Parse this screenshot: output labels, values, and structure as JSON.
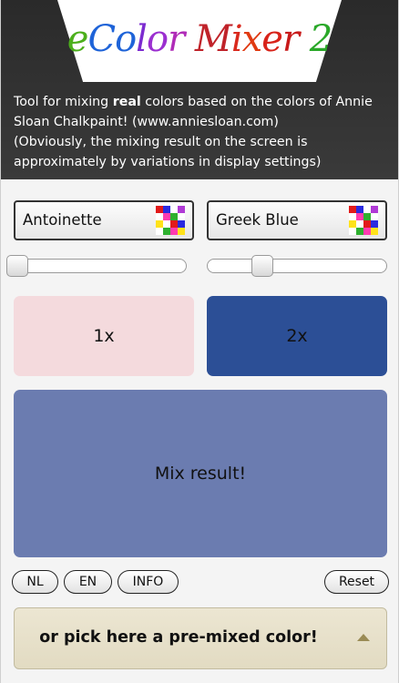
{
  "header": {
    "logo": [
      {
        "text": "e",
        "color": "#4caf1c"
      },
      {
        "text": "C",
        "color": "#1e63d8"
      },
      {
        "text": "o",
        "color": "#1e63d8"
      },
      {
        "text": "l",
        "color": "#7c2bd0"
      },
      {
        "text": "o",
        "color": "#9b2fd0"
      },
      {
        "text": "r",
        "color": "#b02cb8"
      },
      {
        "text": " ",
        "color": "#ffffff"
      },
      {
        "text": "M",
        "color": "#c0232a"
      },
      {
        "text": "i",
        "color": "#d92a1e"
      },
      {
        "text": "x",
        "color": "#e03a12"
      },
      {
        "text": "e",
        "color": "#d8231a"
      },
      {
        "text": "r",
        "color": "#c81a1a"
      },
      {
        "text": " ",
        "color": "#ffffff"
      },
      {
        "text": "2",
        "color": "#2aa829"
      }
    ],
    "intro_before_bold": "Tool for mixing ",
    "intro_bold": "real",
    "intro_after_bold": " colors based on the colors of Annie Sloan Chalkpaint! (www.anniesloan.com)",
    "intro_note": "(Obviously, the mixing result on the screen is approximately by variations in display settings)"
  },
  "colors": {
    "left_name": "Antoinette",
    "right_name": "Greek Blue",
    "left_swatch": "#f4dadd",
    "right_swatch": "#2c4f96",
    "mix_swatch": "#6b7cb0",
    "palette_icon": [
      "#e21a1a",
      "#2a2ae0",
      "#ffffff",
      "#b03ad6",
      "#ffffff",
      "#ff3bb0",
      "#2fb02f",
      "#ffffff",
      "#ffe21a",
      "#ffffff",
      "#e21a1a",
      "#2a2ae0",
      "#ffffff",
      "#2fb02f",
      "#ff3bb0",
      "#ffe21a"
    ]
  },
  "sliders": {
    "left_value": 0,
    "right_value": 0.28
  },
  "swatches": {
    "left_label": "1x",
    "right_label": "2x",
    "mix_label": "Mix result!"
  },
  "buttons": {
    "nl": "NL",
    "en": "EN",
    "info": "INFO",
    "reset": "Reset"
  },
  "premix": {
    "label": "or pick here a pre-mixed color!"
  }
}
